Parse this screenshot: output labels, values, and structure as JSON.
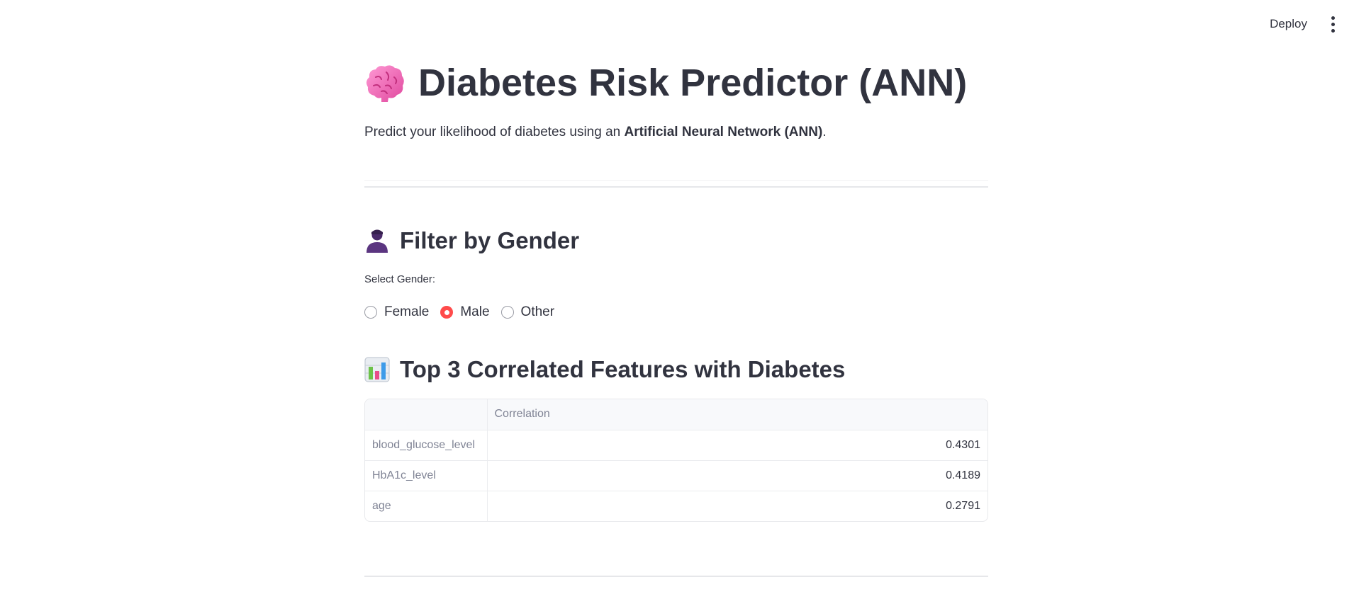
{
  "toolbar": {
    "deploy_label": "Deploy",
    "menu_icon": "more-vertical-icon"
  },
  "header": {
    "title_icon": "brain-icon",
    "title": "Diabetes Risk Predictor (ANN)",
    "subtitle_prefix": "Predict your likelihood of diabetes using an ",
    "subtitle_bold": "Artificial Neural Network (ANN)",
    "subtitle_suffix": "."
  },
  "gender_section": {
    "icon": "person-silhouette-icon",
    "heading": "Filter by Gender",
    "label": "Select Gender:",
    "options": [
      "Female",
      "Male",
      "Other"
    ],
    "selected": "Male"
  },
  "correlation_section": {
    "icon": "bar-chart-icon",
    "heading": "Top 3 Correlated Features with Diabetes",
    "table": {
      "index_header": "",
      "column_header": "Correlation",
      "rows": [
        {
          "feature": "blood_glucose_level",
          "value": "0.4301"
        },
        {
          "feature": "HbA1c_level",
          "value": "0.4189"
        },
        {
          "feature": "age",
          "value": "0.2791"
        }
      ]
    }
  },
  "colors": {
    "text": "#31333F",
    "muted": "#808495",
    "accent": "#ff4b4b",
    "border": "#e6e7ea"
  }
}
